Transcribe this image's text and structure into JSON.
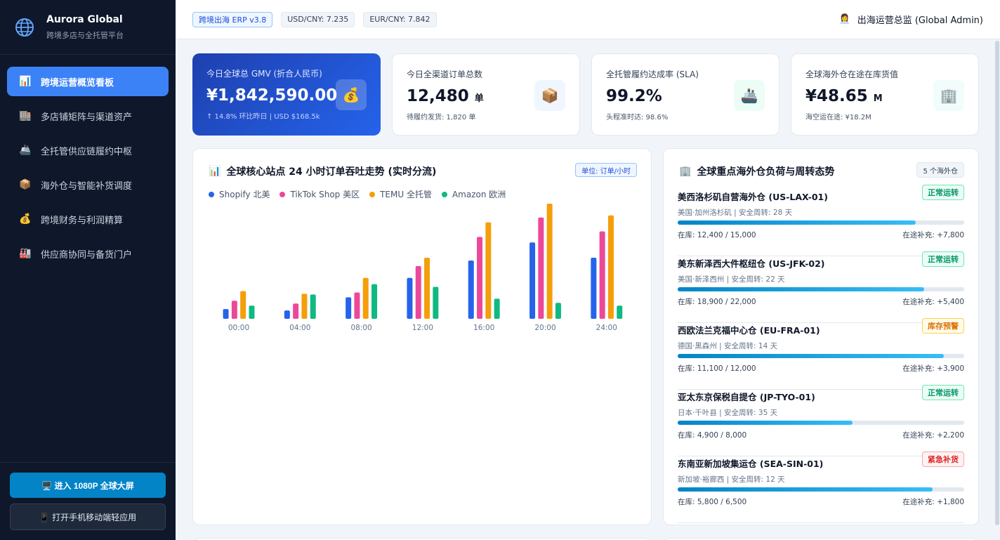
{
  "brand": {
    "title": "Aurora Global",
    "subtitle": "跨境多店与全托管平台",
    "icon": "globe-icon"
  },
  "nav": [
    {
      "label": "跨境运营概览看板",
      "icon": "📊",
      "active": true
    },
    {
      "label": "多店铺矩阵与渠道资产",
      "icon": "🏬",
      "active": false
    },
    {
      "label": "全托管供应链履约中枢",
      "icon": "🚢",
      "active": false
    },
    {
      "label": "海外仓与智能补货调度",
      "icon": "📦",
      "active": false
    },
    {
      "label": "跨境财务与利润精算",
      "icon": "💰",
      "active": false
    },
    {
      "label": "供应商协同与备货门户",
      "icon": "🏭",
      "active": false
    }
  ],
  "sidebar_buttons": {
    "screen": "🖥️ 进入 1080P 全球大屏",
    "mobile": "📱 打开手机移动端轻应用"
  },
  "topbar": {
    "version_tag": "跨境出海 ERP v3.8",
    "usd_rate": "USD/CNY: 7.235",
    "eur_rate": "EUR/CNY: 7.842",
    "user_icon": "👩‍💼",
    "user": "出海运营总监 (Global Admin)"
  },
  "kpis": [
    {
      "label": "今日全球总 GMV (折合人民币)",
      "value": "¥1,842,590.00",
      "unit": "",
      "sub": "↑ 14.8% 环比昨日 | USD $168.5k",
      "icon": "💰",
      "icon_bg": "rgba(255,255,255,0.2)"
    },
    {
      "label": "今日全渠道订单总数",
      "value": "12,480",
      "unit": "单",
      "sub": "待履约发货: 1,820 单",
      "icon": "📦",
      "icon_bg": "#eff6ff"
    },
    {
      "label": "全托管履约达成率 (SLA)",
      "value": "99.2%",
      "unit": "",
      "sub": "头程准时达: 98.6%",
      "icon": "🚢",
      "icon_bg": "#ecfdf5"
    },
    {
      "label": "全球海外仓在途在库货值",
      "value": "¥48.65",
      "unit": "M",
      "sub": "海空运在途: ¥18.2M",
      "icon": "🏢",
      "icon_bg": "#f0fdfa"
    }
  ],
  "chart_panel": {
    "icon": "📊",
    "title": "全球核心站点 24 小时订单吞吐走势 (实时分流)",
    "unit_badge": "单位: 订单/小时"
  },
  "chart_data": {
    "type": "bar",
    "categories": [
      "00:00",
      "04:00",
      "08:00",
      "12:00",
      "16:00",
      "20:00",
      "24:00"
    ],
    "series": [
      {
        "name": "Shopify 北美",
        "color": "#2563eb",
        "values": [
          14,
          12,
          31,
          59,
          84,
          110,
          88
        ]
      },
      {
        "name": "TikTok Shop 美区",
        "color": "#ec4899",
        "values": [
          26,
          22,
          38,
          76,
          118,
          146,
          126
        ]
      },
      {
        "name": "TEMU 全托管",
        "color": "#f59e0b",
        "values": [
          40,
          36,
          59,
          88,
          139,
          166,
          149
        ]
      },
      {
        "name": "Amazon 欧洲",
        "color": "#10b981",
        "values": [
          19,
          35,
          50,
          46,
          29,
          23,
          19
        ]
      }
    ],
    "ylim": [
      0,
      170
    ]
  },
  "warehouse_panel": {
    "icon": "🏢",
    "title": "全球重点海外仓负荷与周转态势",
    "count": "5 个海外仓",
    "items": [
      {
        "name": "美西洛杉矶自营海外仓 (US-LAX-01)",
        "meta": "美国·加州洛杉矶 | 安全周转: 28 天",
        "status": "正常运转",
        "status_class": "st-ok",
        "fill": 0.83,
        "stock": "在库: 12,400 / 15,000",
        "transit": "在途补充: +7,800"
      },
      {
        "name": "美东新泽西大件枢纽仓 (US-JFK-02)",
        "meta": "美国·新泽西州 | 安全周转: 22 天",
        "status": "正常运转",
        "status_class": "st-ok",
        "fill": 0.86,
        "stock": "在库: 18,900 / 22,000",
        "transit": "在途补充: +5,400"
      },
      {
        "name": "西欧法兰克福中心仓 (EU-FRA-01)",
        "meta": "德国·黑森州 | 安全周转: 14 天",
        "status": "库存预警",
        "status_class": "st-warn",
        "fill": 0.93,
        "stock": "在库: 11,100 / 12,000",
        "transit": "在途补充: +3,900"
      },
      {
        "name": "亚太东京保税自提仓 (JP-TYO-01)",
        "meta": "日本·千叶县 | 安全周转: 35 天",
        "status": "正常运转",
        "status_class": "st-ok",
        "fill": 0.61,
        "stock": "在库: 4,900 / 8,000",
        "transit": "在途补充: +2,200"
      },
      {
        "name": "东南亚新加坡集运仓 (SEA-SIN-01)",
        "meta": "新加坡·裕廊西 | 安全周转: 12 天",
        "status": "紧急补货",
        "status_class": "st-bad",
        "fill": 0.89,
        "stock": "在库: 5,800 / 6,500",
        "transit": "在途补充: +1,800"
      }
    ]
  }
}
